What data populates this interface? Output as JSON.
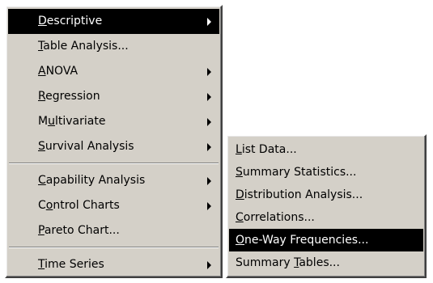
{
  "main_menu": {
    "items": [
      {
        "pre": "",
        "key": "D",
        "post": "escriptive",
        "submenu": true,
        "highlighted": true
      },
      {
        "pre": "",
        "key": "T",
        "post": "able Analysis...",
        "submenu": false
      },
      {
        "pre": "",
        "key": "A",
        "post": "NOVA",
        "submenu": true
      },
      {
        "pre": "",
        "key": "R",
        "post": "egression",
        "submenu": true
      },
      {
        "pre": "M",
        "key": "u",
        "post": "ltivariate",
        "submenu": true
      },
      {
        "pre": "",
        "key": "S",
        "post": "urvival Analysis",
        "submenu": true
      },
      {
        "pre": "",
        "key": "C",
        "post": "apability Analysis",
        "submenu": true
      },
      {
        "pre": "C",
        "key": "o",
        "post": "ntrol Charts",
        "submenu": true
      },
      {
        "pre": "",
        "key": "P",
        "post": "areto Chart...",
        "submenu": false
      },
      {
        "pre": "",
        "key": "T",
        "post": "ime Series",
        "submenu": true
      }
    ]
  },
  "sub_menu": {
    "items": [
      {
        "pre": "",
        "key": "L",
        "post": "ist Data...",
        "highlighted": false
      },
      {
        "pre": "",
        "key": "S",
        "post": "ummary Statistics...",
        "highlighted": false
      },
      {
        "pre": "",
        "key": "D",
        "post": "istribution Analysis...",
        "highlighted": false
      },
      {
        "pre": "",
        "key": "C",
        "post": "orrelations...",
        "highlighted": false
      },
      {
        "pre": "",
        "key": "O",
        "post": "ne-Way Frequencies...",
        "highlighted": true
      },
      {
        "pre": "Summary ",
        "key": "T",
        "post": "ables...",
        "highlighted": false
      }
    ]
  },
  "colors": {
    "menu_bg": "#d4d0c8",
    "highlight_bg": "#000000",
    "highlight_fg": "#ffffff"
  }
}
